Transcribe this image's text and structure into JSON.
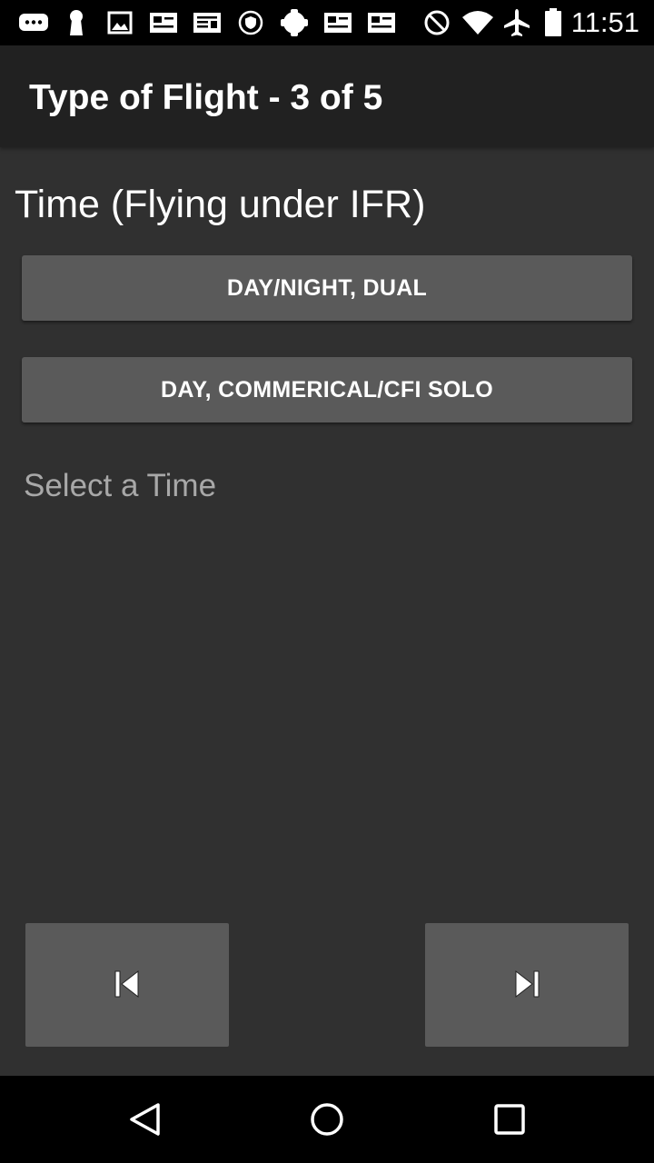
{
  "status_bar": {
    "time": "11:51",
    "left_icons": [
      "chat-icon",
      "keyhole-icon",
      "image-icon",
      "news-icon",
      "article-icon",
      "shield-icon",
      "android-icon",
      "news-icon",
      "news-icon"
    ],
    "right_icons": [
      "do-not-disturb-icon",
      "wifi-icon",
      "airplane-icon",
      "battery-icon"
    ]
  },
  "app_bar": {
    "title": "Type of Flight - 3 of 5"
  },
  "main": {
    "section_title": "Time (Flying under IFR)",
    "options": [
      {
        "label": "DAY/NIGHT, DUAL"
      },
      {
        "label": "DAY, COMMERICAL/CFI SOLO"
      }
    ],
    "hint": "Select a Time"
  },
  "navigation": {
    "prev_icon": "skip-previous-icon",
    "next_icon": "skip-next-icon"
  },
  "system_nav": {
    "icons": [
      "back-icon",
      "home-icon",
      "recents-icon"
    ]
  },
  "colors": {
    "background": "#303030",
    "app_bar": "#212121",
    "button": "#5a5a5a",
    "hint_text": "#a8a8a8"
  }
}
